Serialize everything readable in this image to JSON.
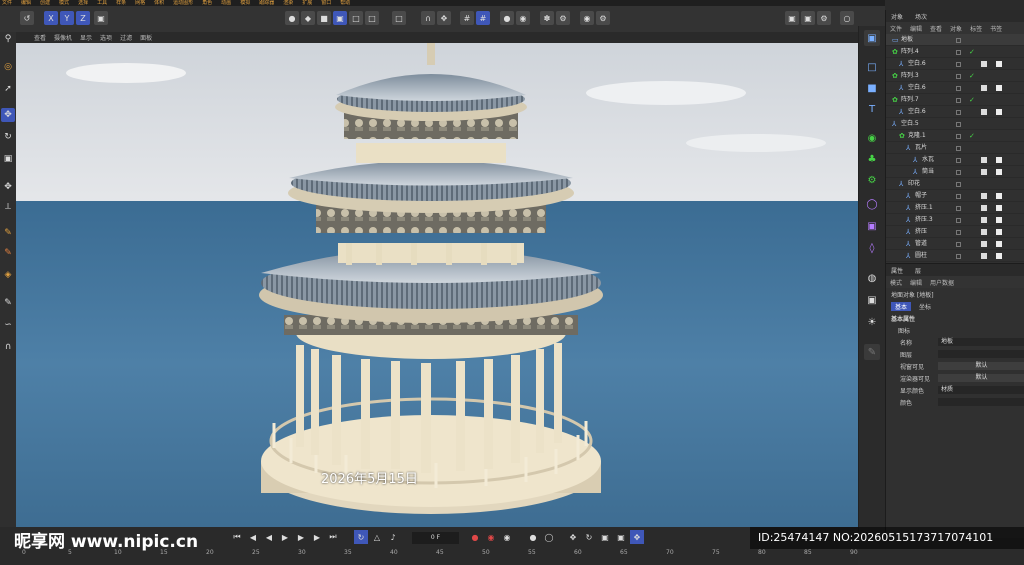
{
  "menubar": [
    "文件",
    "编辑",
    "创建",
    "模式",
    "选择",
    "工具",
    "样条",
    "网格",
    "体积",
    "运动图形",
    "角色",
    "动画",
    "模拟",
    "跟踪器",
    "渲染",
    "扩展",
    "窗口",
    "帮助"
  ],
  "toolbar": {
    "icons": [
      "undo-icon",
      "cube-icon",
      "axis-x",
      "axis-y",
      "axis-z",
      "coordinate-icon"
    ],
    "axes": [
      "X",
      "Y",
      "Z"
    ]
  },
  "viewport_menu": [
    "查看",
    "摄像机",
    "显示",
    "选项",
    "过滤",
    "面板"
  ],
  "viewport": {
    "date_text": "2026年5月15日"
  },
  "object_manager": {
    "tabs": [
      "对象",
      "场次"
    ],
    "menu": [
      "文件",
      "编辑",
      "查看",
      "对象",
      "标签",
      "书签"
    ],
    "rows": [
      {
        "name": "地板",
        "indent": 0,
        "icon": "floor-icon",
        "check": false,
        "tags": 0
      },
      {
        "name": "阵列.4",
        "indent": 0,
        "icon": "array-icon",
        "check": true,
        "tags": 0
      },
      {
        "name": "空白.6",
        "indent": 1,
        "icon": "null-icon",
        "check": false,
        "tags": 2
      },
      {
        "name": "阵列.3",
        "indent": 0,
        "icon": "array-icon",
        "check": true,
        "tags": 0
      },
      {
        "name": "空白.6",
        "indent": 1,
        "icon": "null-icon",
        "check": false,
        "tags": 2
      },
      {
        "name": "阵列.7",
        "indent": 0,
        "icon": "array-icon",
        "check": true,
        "tags": 0
      },
      {
        "name": "空白.6",
        "indent": 1,
        "icon": "null-icon",
        "check": false,
        "tags": 2
      },
      {
        "name": "空白.5",
        "indent": 0,
        "icon": "null-icon",
        "check": false,
        "tags": 0
      },
      {
        "name": "克隆.1",
        "indent": 1,
        "icon": "cloner-icon",
        "check": true,
        "tags": 0
      },
      {
        "name": "瓦片",
        "indent": 2,
        "icon": "null-icon",
        "check": false,
        "tags": 0
      },
      {
        "name": "水瓦",
        "indent": 3,
        "icon": "null-icon",
        "check": false,
        "tags": 2
      },
      {
        "name": "筒当",
        "indent": 3,
        "icon": "null-icon",
        "check": false,
        "tags": 2
      },
      {
        "name": "印花",
        "indent": 1,
        "icon": "null-icon",
        "check": false,
        "tags": 0
      },
      {
        "name": "帽子",
        "indent": 2,
        "icon": "null-icon",
        "check": false,
        "tags": 2
      },
      {
        "name": "挤压.1",
        "indent": 2,
        "icon": "null-icon",
        "check": false,
        "tags": 2
      },
      {
        "name": "挤压.3",
        "indent": 2,
        "icon": "null-icon",
        "check": false,
        "tags": 2
      },
      {
        "name": "挤压",
        "indent": 2,
        "icon": "null-icon",
        "check": false,
        "tags": 2
      },
      {
        "name": "管道",
        "indent": 2,
        "icon": "null-icon",
        "check": false,
        "tags": 2
      },
      {
        "name": "圆柱",
        "indent": 2,
        "icon": "null-icon",
        "check": false,
        "tags": 2
      }
    ]
  },
  "attributes": {
    "tabs": [
      "属性",
      "层"
    ],
    "menu": [
      "模式",
      "编辑",
      "用户数据"
    ],
    "object_title": "地面对象 [地板]",
    "subtabs": [
      "基本",
      "坐标"
    ],
    "section": "基本属性",
    "icon_label": "图标",
    "fields": [
      {
        "label": "名称",
        "value": "地板",
        "type": "text"
      },
      {
        "label": "图层",
        "value": "",
        "type": "text"
      },
      {
        "label": "视窗可见",
        "value": "默认",
        "type": "button"
      },
      {
        "label": "渲染器可见",
        "value": "默认",
        "type": "button"
      },
      {
        "label": "显示颜色",
        "value": "材质",
        "type": "text"
      },
      {
        "label": "颜色",
        "value": "",
        "type": "text"
      }
    ]
  },
  "timeline": {
    "frame": "0 F",
    "ruler": [
      "0",
      "5",
      "10",
      "15",
      "20",
      "25",
      "30",
      "35",
      "40",
      "45",
      "50",
      "55",
      "60",
      "65",
      "70",
      "75",
      "80",
      "85",
      "90"
    ]
  },
  "watermark": {
    "logo": "昵享网 www.nipic.cn",
    "id_text": "ID:25474147 NO:20260515173717074101"
  },
  "colors": {
    "accent": "#3f57b8",
    "check": "#46d246",
    "menu": "#e0a040"
  }
}
